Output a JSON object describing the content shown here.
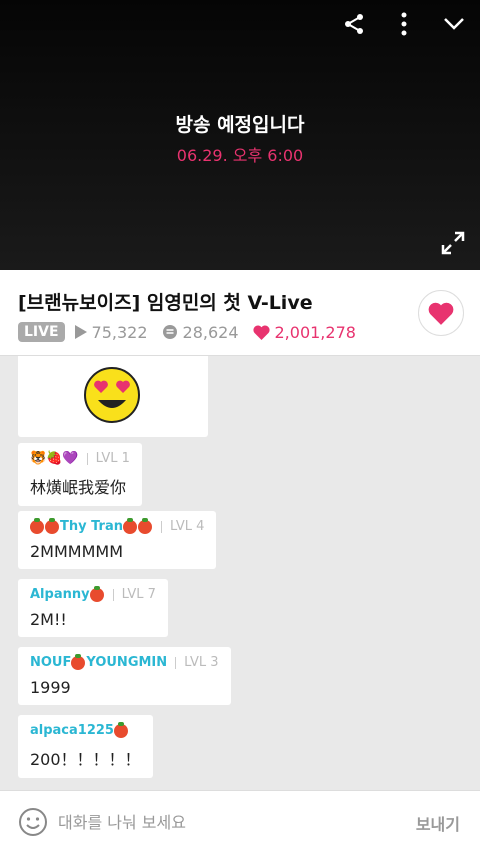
{
  "player": {
    "notice": "방송 예정입니다",
    "schedule": "06.29. 오후 6:00"
  },
  "info": {
    "title": "[브랜뉴보이즈] 임영민의 첫 V-Live",
    "live_label": "LIVE",
    "plays": "75,322",
    "comments": "28,624",
    "hearts": "2,001,278"
  },
  "chat": {
    "messages": [
      {
        "name": "🐯🍓💜",
        "level": "LVL 1",
        "text": "林熿岷我爱你"
      },
      {
        "name": "Thy Tran",
        "level": "LVL 4",
        "text": "2MMMMMM"
      },
      {
        "name": "Alpanny",
        "level": "LVL 7",
        "text": "2M!!"
      },
      {
        "name": "NOUF",
        "name2": "YOUNGMIN",
        "level": "LVL 3",
        "text": "1999"
      },
      {
        "name": "alpaca1225",
        "level": "",
        "text": "200！！！！！"
      }
    ]
  },
  "composer": {
    "placeholder": "대화를 나눠 보세요",
    "send_label": "보내기"
  },
  "colors": {
    "accent": "#e8336f",
    "username": "#2bb7d3"
  }
}
